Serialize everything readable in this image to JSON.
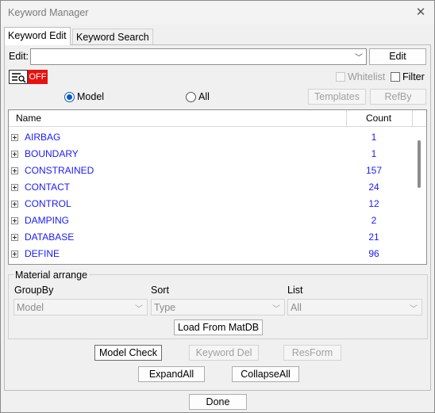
{
  "window": {
    "title": "Keyword Manager"
  },
  "tabs": [
    {
      "label": "Keyword Edit"
    },
    {
      "label": "Keyword Search"
    }
  ],
  "edit": {
    "label": "Edit:",
    "value": "",
    "button": "Edit"
  },
  "filter_toggle": {
    "state": "OFF"
  },
  "whitelist": {
    "label": "Whitelist"
  },
  "filter": {
    "label": "Filter"
  },
  "scope": {
    "model_label": "Model",
    "all_label": "All",
    "selected": "Model"
  },
  "buttons": {
    "templates": "Templates",
    "refby": "RefBy"
  },
  "tree": {
    "col_name": "Name",
    "col_count": "Count",
    "rows": [
      {
        "name": "AIRBAG",
        "count": "1"
      },
      {
        "name": "BOUNDARY",
        "count": "1"
      },
      {
        "name": "CONSTRAINED",
        "count": "157"
      },
      {
        "name": "CONTACT",
        "count": "24"
      },
      {
        "name": "CONTROL",
        "count": "12"
      },
      {
        "name": "DAMPING",
        "count": "2"
      },
      {
        "name": "DATABASE",
        "count": "21"
      },
      {
        "name": "DEFINE",
        "count": "96"
      }
    ]
  },
  "material": {
    "title": "Material arrange",
    "groupby_label": "GroupBy",
    "groupby_value": "Model",
    "sort_label": "Sort",
    "sort_value": "Type",
    "list_label": "List",
    "list_value": "All",
    "load_button": "Load From MatDB"
  },
  "actions": {
    "model_check": "Model Check",
    "keyword_del": "Keyword Del",
    "resform": "ResForm",
    "expand_all": "ExpandAll",
    "collapse_all": "CollapseAll",
    "done": "Done"
  },
  "colors": {
    "accent": "#0a59c4",
    "link": "#1a1aff",
    "off": "#e81010"
  }
}
